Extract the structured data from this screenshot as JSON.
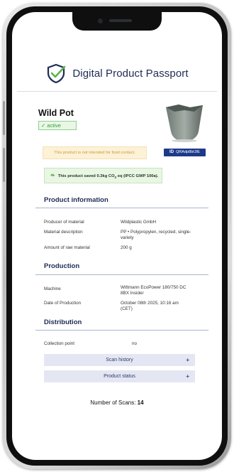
{
  "app": {
    "title": "Digital Product Passport"
  },
  "product": {
    "name": "Wild Pot",
    "status": "active",
    "warning": "This product is not intended for food contact.",
    "id_label": "ID",
    "id_value": "QRAdp8bt1fE",
    "co2_text": "This product saved 0.3kg CO",
    "co2_sub": "2",
    "co2_tail": " eq (IPCC GWP 100a)."
  },
  "product_information": {
    "title": "Product information",
    "rows": [
      {
        "label": "Producer of material",
        "value": "Wildplastic GmbH"
      },
      {
        "label": "Material description",
        "value": "PP • Polypropylen, recycled, single-variety"
      },
      {
        "label": "Amount of raw material",
        "value": "200 g"
      }
    ]
  },
  "production": {
    "title": "Production",
    "rows": [
      {
        "label": "Machine",
        "value": "Wittmann EcoPower 180/750 DC 8BX Insider"
      },
      {
        "label": "Date of Production",
        "value": "October 08th 2025, 10:16 am (CET)"
      }
    ]
  },
  "distribution": {
    "title": "Distribution",
    "rows": [
      {
        "label": "Collection point",
        "value": "no"
      }
    ]
  },
  "accordions": [
    {
      "label": "Scan history",
      "icon": "+"
    },
    {
      "label": "Product status",
      "icon": "+"
    }
  ],
  "scans": {
    "label": "Number of Scans:",
    "value": "14"
  },
  "colors": {
    "brand": "#1e2b55",
    "accent": "#1c3a8a",
    "active": "#3a9b3a",
    "warning_bg": "#fdf1d6"
  }
}
